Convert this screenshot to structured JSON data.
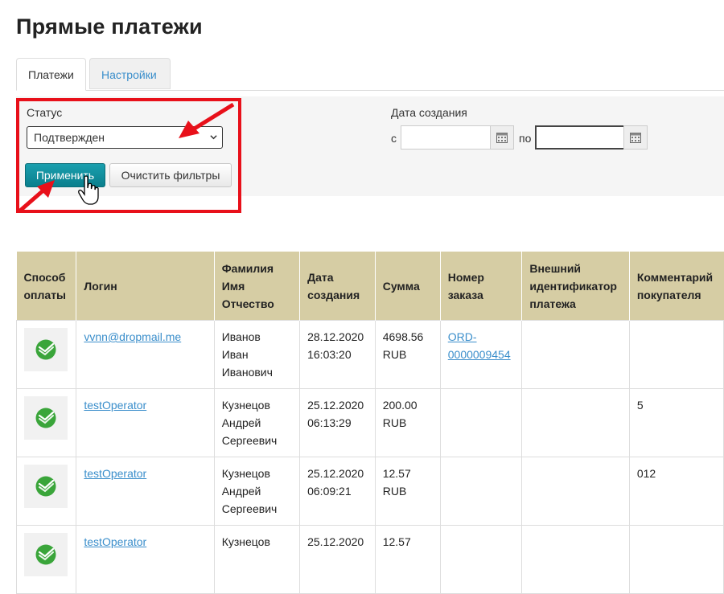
{
  "page": {
    "title": "Прямые платежи"
  },
  "tabs": [
    {
      "label": "Платежи",
      "active": true
    },
    {
      "label": "Настройки",
      "active": false
    }
  ],
  "filters": {
    "status_label": "Статус",
    "status_value": "Подтвержден",
    "apply_label": "Применить",
    "clear_label": "Очистить фильтры",
    "date_label": "Дата создания",
    "from_label": "с",
    "to_label": "по",
    "from_value": "",
    "to_value": ""
  },
  "colors": {
    "highlight": "#e8101a",
    "header_bg": "#d6cda4",
    "apply_bg": "#0f8f9d",
    "link": "#3a8ecb",
    "logo_green": "#3aa53a"
  },
  "table": {
    "headers": [
      [
        "Способ",
        "оплаты"
      ],
      [
        "Логин"
      ],
      [
        "Фамилия",
        "Имя",
        "Отчество"
      ],
      [
        "Дата",
        "создания"
      ],
      [
        "Сумма"
      ],
      [
        "Номер",
        "заказа"
      ],
      [
        "Внешний",
        "идентификатор",
        "платежа"
      ],
      [
        "Комментарий",
        "покупателя"
      ]
    ],
    "rows": [
      {
        "payment_icon": "sberbank-icon",
        "login": "vvnn@dropmail.me",
        "name": [
          "Иванов",
          "Иван",
          "Иванович"
        ],
        "date": [
          "28.12.2020",
          "16:03:20"
        ],
        "sum": [
          "4698.56",
          "RUB"
        ],
        "order": [
          "ORD-",
          "0000009454"
        ],
        "external_id": "",
        "comment": ""
      },
      {
        "payment_icon": "sberbank-icon",
        "login": "testOperator",
        "name": [
          "Кузнецов",
          "Андрей",
          "Сергеевич"
        ],
        "date": [
          "25.12.2020",
          "06:13:29"
        ],
        "sum": [
          "200.00",
          "RUB"
        ],
        "order": [
          "",
          ""
        ],
        "external_id": "",
        "comment": "5"
      },
      {
        "payment_icon": "sberbank-icon",
        "login": "testOperator",
        "name": [
          "Кузнецов",
          "Андрей",
          "Сергеевич"
        ],
        "date": [
          "25.12.2020",
          "06:09:21"
        ],
        "sum": [
          "12.57",
          "RUB"
        ],
        "order": [
          "",
          ""
        ],
        "external_id": "",
        "comment": "012"
      },
      {
        "payment_icon": "sberbank-icon",
        "login": "testOperator",
        "name": [
          "Кузнецов",
          "",
          ""
        ],
        "date": [
          "25.12.2020",
          ""
        ],
        "sum": [
          "12.57",
          ""
        ],
        "order": [
          "",
          ""
        ],
        "external_id": "",
        "comment": ""
      }
    ]
  }
}
